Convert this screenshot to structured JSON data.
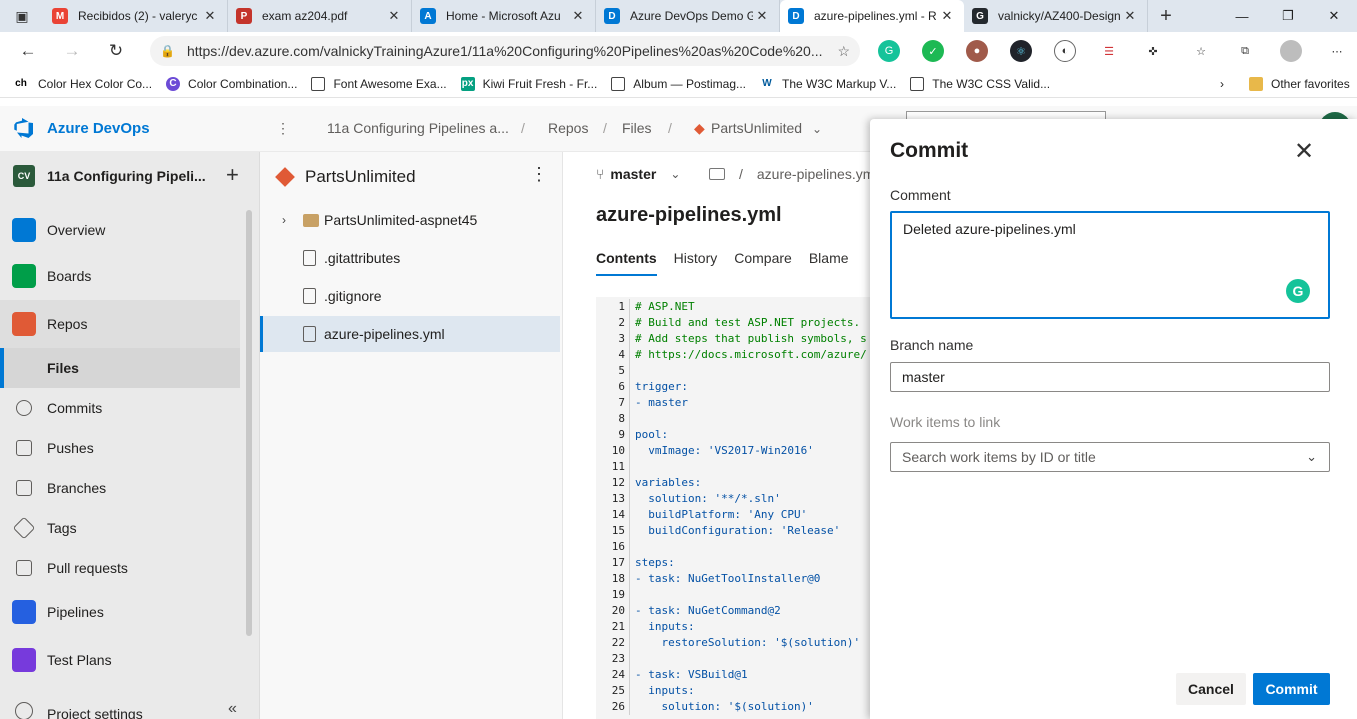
{
  "browser": {
    "tabs": [
      {
        "title": "Recibidos (2) - valeryc",
        "icon": "gmail-icon",
        "color": "#ea4335",
        "glyph": "M"
      },
      {
        "title": "exam az204.pdf",
        "icon": "pdf-icon",
        "color": "#c4342b",
        "glyph": "P"
      },
      {
        "title": "Home - Microsoft Azu",
        "icon": "azure-icon",
        "color": "#0078d4",
        "glyph": "A"
      },
      {
        "title": "Azure DevOps Demo G",
        "icon": "devops-icon",
        "color": "#0078d4",
        "glyph": "D"
      },
      {
        "title": "azure-pipelines.yml - R",
        "icon": "devops-icon",
        "color": "#0078d4",
        "glyph": "D"
      },
      {
        "title": "valnicky/AZ400-Design",
        "icon": "github-icon",
        "color": "#24292e",
        "glyph": "G"
      }
    ],
    "url": "https://dev.azure.com/valnickyTrainingAzure1/11a%20Configuring%20Pipelines%20as%20Code%20...",
    "favorites": [
      {
        "label": "Color Hex Color Co...",
        "glyph": "ch"
      },
      {
        "label": "Color Combination...",
        "glyph": "C"
      },
      {
        "label": "Font Awesome Exa...",
        "glyph": ""
      },
      {
        "label": "Kiwi Fruit Fresh - Fr...",
        "glyph": "px"
      },
      {
        "label": "Album — Postimag...",
        "glyph": ""
      },
      {
        "label": "The W3C Markup V...",
        "glyph": "W"
      },
      {
        "label": "The W3C CSS Valid...",
        "glyph": ""
      }
    ],
    "other_favorites": "Other favorites"
  },
  "header": {
    "brand": "Azure DevOps",
    "breadcrumbs": [
      "11a Configuring Pipelines a...",
      "Repos",
      "Files",
      "PartsUnlimited"
    ]
  },
  "project": {
    "initials": "CV",
    "name": "11a Configuring Pipeli..."
  },
  "nav": {
    "overview": "Overview",
    "boards": "Boards",
    "repos": "Repos",
    "files": "Files",
    "commits": "Commits",
    "pushes": "Pushes",
    "branches": "Branches",
    "tags": "Tags",
    "pull_requests": "Pull requests",
    "pipelines": "Pipelines",
    "test_plans": "Test Plans",
    "project_settings": "Project settings"
  },
  "tree": {
    "repo": "PartsUnlimited",
    "items": [
      "PartsUnlimited-aspnet45",
      ".gitattributes",
      ".gitignore",
      "azure-pipelines.yml"
    ]
  },
  "content": {
    "branch": "master",
    "path": "azure-pipelines.yml",
    "file_title": "azure-pipelines.yml",
    "tabs": [
      "Contents",
      "History",
      "Compare",
      "Blame"
    ],
    "code": [
      {
        "n": "1",
        "t": "# ASP.NET",
        "c": "comment"
      },
      {
        "n": "2",
        "t": "# Build and test ASP.NET projects.",
        "c": "comment"
      },
      {
        "n": "3",
        "t": "# Add steps that publish symbols, s",
        "c": "comment"
      },
      {
        "n": "4",
        "t": "# https://docs.microsoft.com/azure/",
        "c": "comment"
      },
      {
        "n": "5",
        "t": "",
        "c": ""
      },
      {
        "n": "6",
        "t": "trigger:",
        "c": "key"
      },
      {
        "n": "7",
        "t": "- master",
        "c": "key"
      },
      {
        "n": "8",
        "t": "",
        "c": ""
      },
      {
        "n": "9",
        "t": "pool:",
        "c": "key"
      },
      {
        "n": "10",
        "t": "  vmImage: 'VS2017-Win2016'",
        "c": "key"
      },
      {
        "n": "11",
        "t": "",
        "c": ""
      },
      {
        "n": "12",
        "t": "variables:",
        "c": "key"
      },
      {
        "n": "13",
        "t": "  solution: '**/*.sln'",
        "c": "key"
      },
      {
        "n": "14",
        "t": "  buildPlatform: 'Any CPU'",
        "c": "key"
      },
      {
        "n": "15",
        "t": "  buildConfiguration: 'Release'",
        "c": "key"
      },
      {
        "n": "16",
        "t": "",
        "c": ""
      },
      {
        "n": "17",
        "t": "steps:",
        "c": "key"
      },
      {
        "n": "18",
        "t": "- task: NuGetToolInstaller@0",
        "c": "key"
      },
      {
        "n": "19",
        "t": "",
        "c": ""
      },
      {
        "n": "20",
        "t": "- task: NuGetCommand@2",
        "c": "key"
      },
      {
        "n": "21",
        "t": "  inputs:",
        "c": "key"
      },
      {
        "n": "22",
        "t": "    restoreSolution: '$(solution)'",
        "c": "key"
      },
      {
        "n": "23",
        "t": "",
        "c": ""
      },
      {
        "n": "24",
        "t": "- task: VSBuild@1",
        "c": "key"
      },
      {
        "n": "25",
        "t": "  inputs:",
        "c": "key"
      },
      {
        "n": "26",
        "t": "    solution: '$(solution)'",
        "c": "key"
      }
    ]
  },
  "commit_panel": {
    "title": "Commit",
    "comment_label": "Comment",
    "comment_value": "Deleted azure-pipelines.yml",
    "branch_label": "Branch name",
    "branch_value": "master",
    "work_items_label": "Work items to link",
    "work_items_placeholder": "Search work items by ID or title",
    "cancel": "Cancel",
    "commit": "Commit"
  },
  "colors": {
    "accent": "#0078d4",
    "nav_bg": "#eaeaea",
    "selected_tree": "#dee7f0"
  }
}
